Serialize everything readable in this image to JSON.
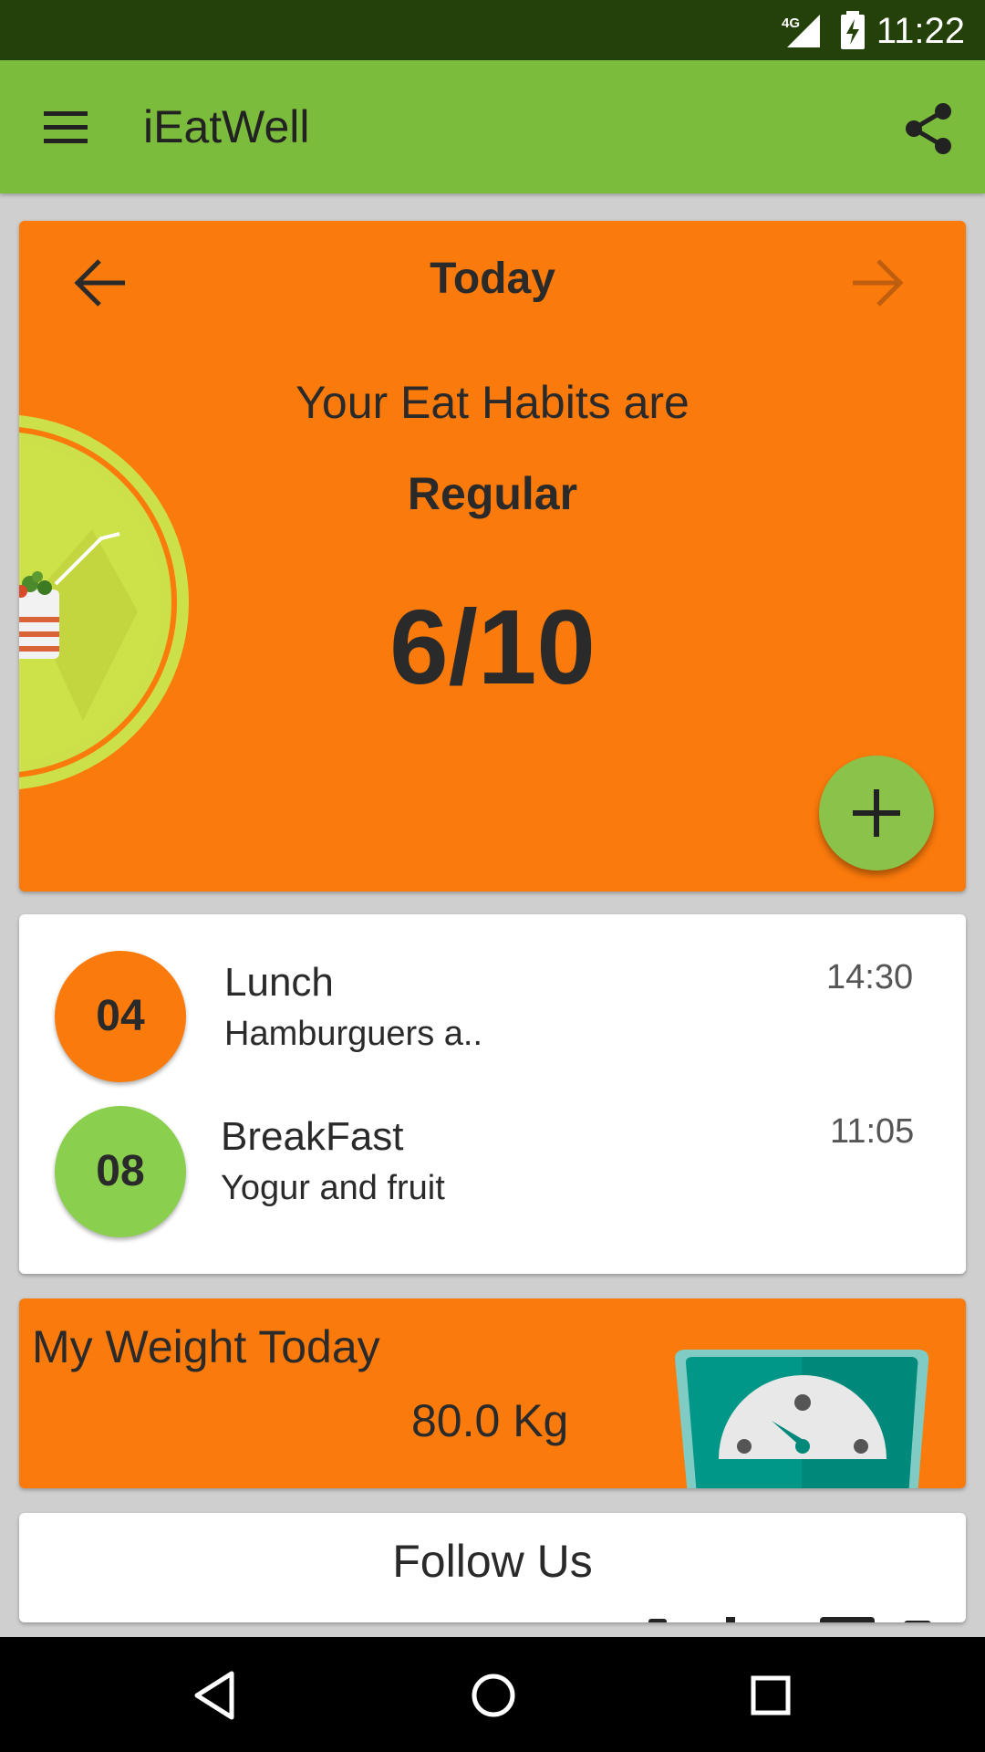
{
  "status_bar": {
    "time": "11:22",
    "network": "4G"
  },
  "app_bar": {
    "title": "iEatWell"
  },
  "summary_card": {
    "day_label": "Today",
    "habit_text": "Your Eat Habits are",
    "habit_level": "Regular",
    "score": "6/10"
  },
  "meals": [
    {
      "count": "04",
      "name": "Lunch",
      "description": "Hamburguers a..",
      "time": "14:30",
      "color": "#fb7a0c"
    },
    {
      "count": "08",
      "name": "BreakFast",
      "description": "Yogur and fruit",
      "time": "11:05",
      "color": "#8bcf4f"
    }
  ],
  "weight_card": {
    "label": "My Weight Today",
    "value": "80.0 Kg"
  },
  "follow_card": {
    "label": "Follow Us"
  },
  "colors": {
    "app_bar": "#7cbc3c",
    "status_bar": "#24410a",
    "card_orange": "#fb7a0c",
    "fab": "#8bc34a"
  },
  "icons": [
    "menu-icon",
    "share-icon",
    "arrow-back-icon",
    "arrow-forward-icon",
    "add-icon",
    "plate-illustration",
    "scale-icon",
    "nav-back-icon",
    "nav-home-icon",
    "nav-recents-icon"
  ]
}
